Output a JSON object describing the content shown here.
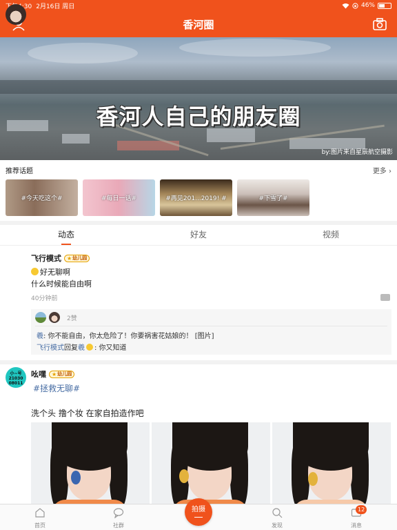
{
  "status_bar": {
    "time": "下午4:30",
    "date": "2月16日 周日",
    "battery": "46%"
  },
  "nav": {
    "title": "香河圈"
  },
  "banner": {
    "title": "香河人自己的朋友圈",
    "credit": "by:图片来自星辰航空摄影"
  },
  "topics": {
    "header": "推荐话题",
    "more": "更多 ›",
    "items": [
      {
        "label": "#今天吃这个#"
      },
      {
        "label": "#每日一话#"
      },
      {
        "label": "#再见201...2019! #"
      },
      {
        "label": "#下雪了#"
      }
    ]
  },
  "tabs": [
    {
      "label": "动态"
    },
    {
      "label": "好友"
    },
    {
      "label": "视频"
    }
  ],
  "post1": {
    "username": "飞行模式",
    "badge": "幼儿园",
    "line1": "好无聊啊",
    "line2": "什么时候能自由啊",
    "time": "40分钟前",
    "likes": "2赞",
    "comment1_name": "羲",
    "comment1_text": ": 你不能自由，你太危险了！你要祸害花姑娘的！ [图片]",
    "comment2_name": "飞行模式",
    "comment2_mid": "回复",
    "comment2_target": "羲",
    "comment2_text": ": 你又知道"
  },
  "post2": {
    "username": "吆嘿",
    "badge": "幼儿园",
    "avatar_text": "小~号 21030 08011",
    "hashtag": "#拯救无聊#",
    "caption": "洗个头 撸个妆 在家自拍造作吧"
  },
  "tabbar": {
    "home": "首页",
    "community": "社群",
    "shoot": "拍摄",
    "discover": "发现",
    "messages": "消息",
    "messages_badge": "12"
  },
  "colors": {
    "accent": "#f0521c",
    "link": "#4a6fa5"
  }
}
